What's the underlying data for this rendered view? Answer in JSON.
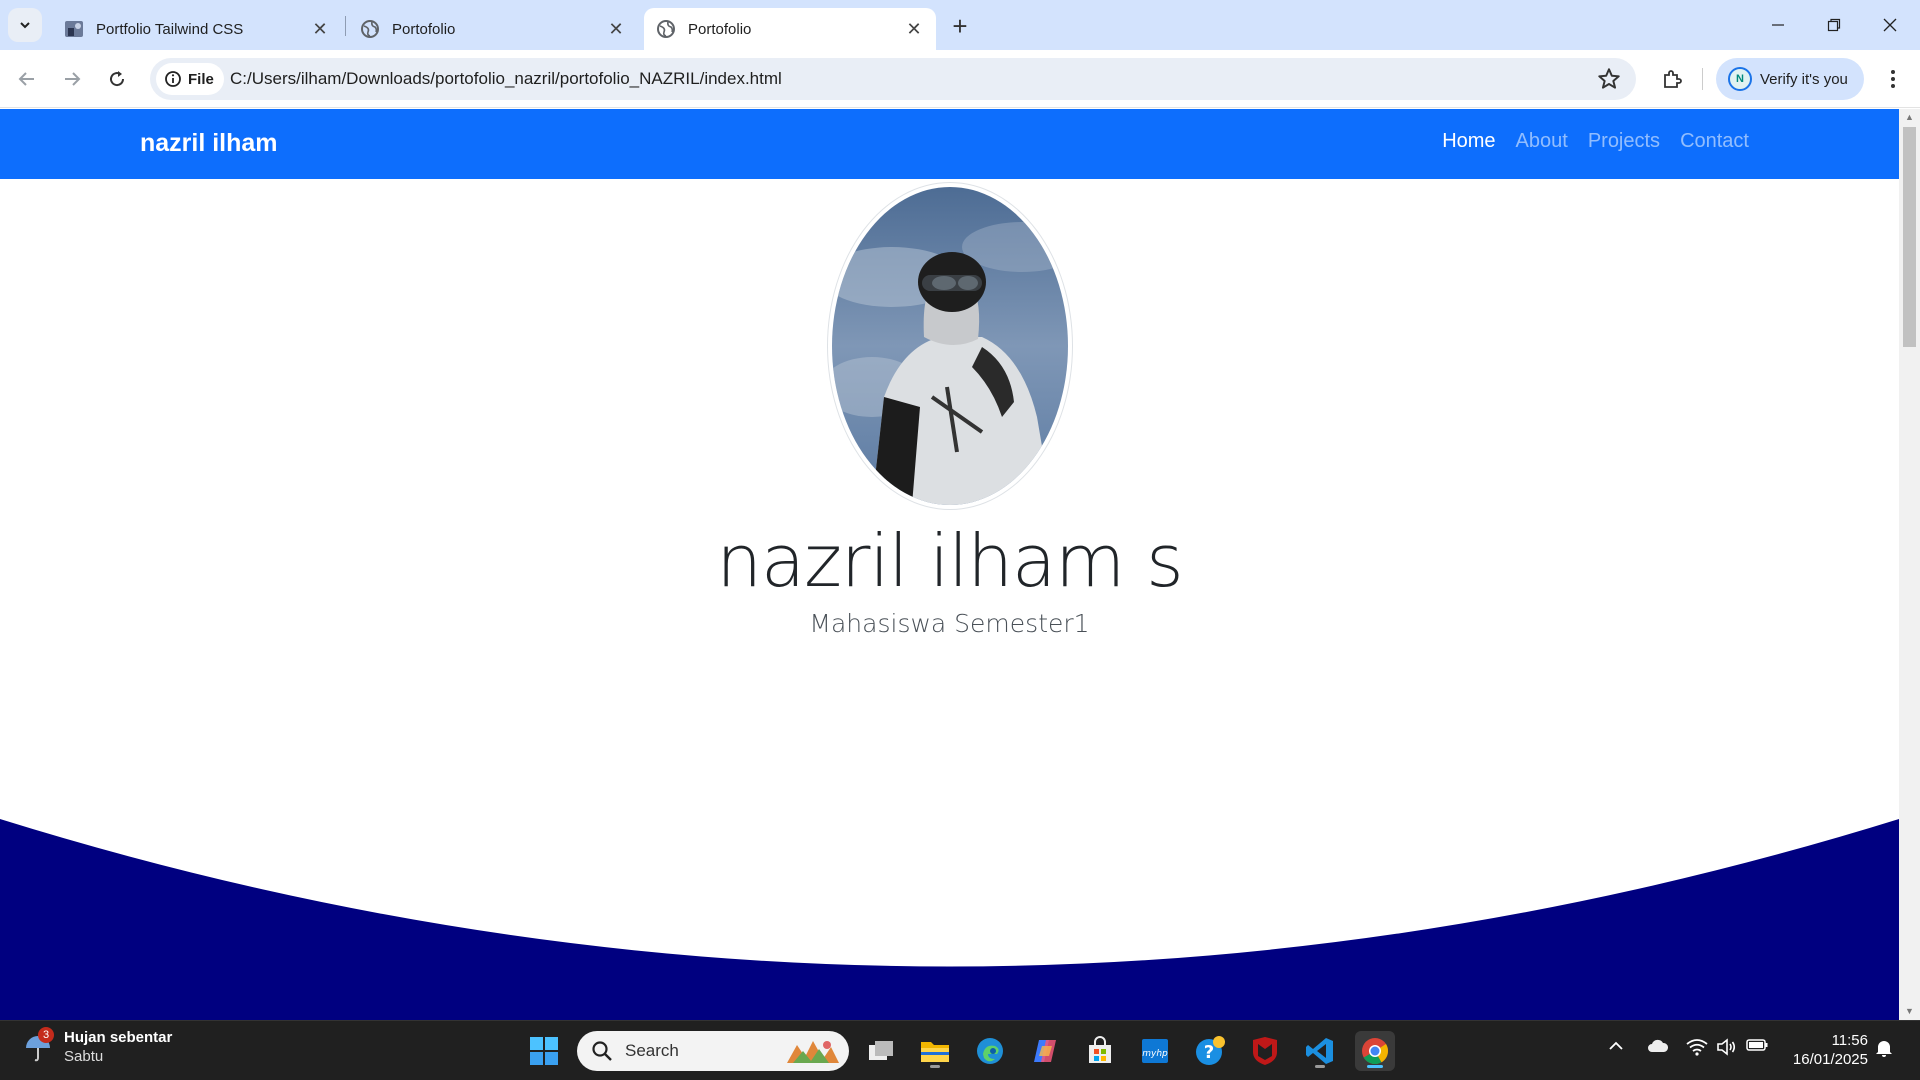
{
  "browser": {
    "tabs": [
      {
        "title": "Portfolio Tailwind CSS",
        "active": false
      },
      {
        "title": "Portofolio",
        "active": false
      },
      {
        "title": "Portofolio",
        "active": true
      }
    ],
    "close_glyph": "✕",
    "new_tab_glyph": "+",
    "file_chip": "File",
    "url": "C:/Users/ilham/Downloads/portofolio_nazril/portofolio_NAZRIL/index.html",
    "profile_initial": "N",
    "verify_label": "Verify it's you"
  },
  "page": {
    "brand": "nazril ilham",
    "nav": [
      {
        "label": "Home",
        "active": true
      },
      {
        "label": "About",
        "active": false
      },
      {
        "label": "Projects",
        "active": false
      },
      {
        "label": "Contact",
        "active": false
      }
    ],
    "hero_name": "nazril ilham s",
    "hero_subtitle": "Mahasiswa Semester1",
    "colors": {
      "navbar": "#0d6efd",
      "wave": "#000080"
    }
  },
  "taskbar": {
    "weather_badge": "3",
    "weather_title": "Hujan sebentar",
    "weather_day": "Sabtu",
    "search_label": "Search",
    "time": "11:56",
    "date": "16/01/2025",
    "pinned": [
      "task-view-icon",
      "file-explorer-icon",
      "edge-icon",
      "copilot-icon",
      "ms-store-icon",
      "myhp-icon",
      "hp-support-icon",
      "mcafee-icon",
      "vscode-icon",
      "chrome-icon"
    ]
  }
}
